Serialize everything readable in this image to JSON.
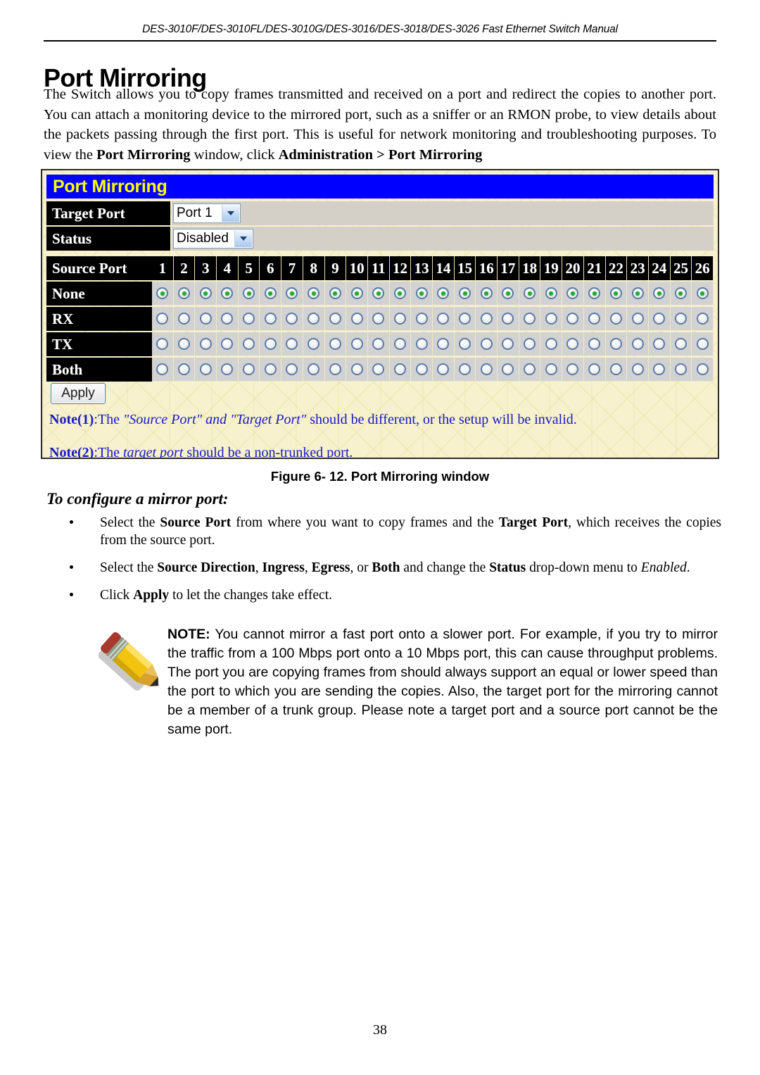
{
  "document": {
    "running_header": "DES-3010F/DES-3010FL/DES-3010G/DES-3016/DES-3018/DES-3026 Fast Ethernet Switch Manual",
    "page_title": "Port Mirroring",
    "page_number": "38"
  },
  "intro": {
    "paragraph_html": "The Switch allows you to copy frames transmitted and received on a port and redirect the copies to another port. You can attach a monitoring device to the mirrored port, such as a sniffer or an RMON probe, to view details about the packets passing through the first port. This is useful for network monitoring and troubleshooting purposes. To view the <b>Port Mirroring</b> window, click <b>Administration &gt; Port Mirroring</b>"
  },
  "screenshot": {
    "window_title": "Port Mirroring",
    "fields": [
      {
        "label": "Target Port",
        "value": "Port 1"
      },
      {
        "label": "Status",
        "value": "Disabled"
      }
    ],
    "source_port_label": "Source Port",
    "port_numbers": [
      "1",
      "2",
      "3",
      "4",
      "5",
      "6",
      "7",
      "8",
      "9",
      "10",
      "11",
      "12",
      "13",
      "14",
      "15",
      "16",
      "17",
      "18",
      "19",
      "20",
      "21",
      "22",
      "23",
      "24",
      "25",
      "26"
    ],
    "direction_rows": [
      {
        "label": "None",
        "selected": true
      },
      {
        "label": "RX",
        "selected": false
      },
      {
        "label": "TX",
        "selected": false
      },
      {
        "label": "Both",
        "selected": false
      }
    ],
    "apply_label": "Apply",
    "notes": [
      "Note(1):The \"Source Port\" and \"Target Port\" should be different, or the setup will be invalid.",
      "Note(2):The target port should be a non-trunked port."
    ],
    "note_html": [
      "<b>Note(1)</b>:The <i>\"Source Port\" and \"Target Port\"</i> should be different, or the setup will be invalid.",
      "<b>Note(2)</b>:The <i>target port</i> should be a non-trunked port."
    ],
    "colors": {
      "titlebar_bg": "#0000ff",
      "titlebar_fg": "#ffff00",
      "label_bg": "#000000",
      "label_fg": "#ffffff",
      "cell_bg": "#d2d2d2",
      "panel_bg": "#f7f2cd",
      "note_fg": "#1818c8",
      "radio_selected": "#1faf2f"
    }
  },
  "caption": "Figure 6- 12.  Port Mirroring window",
  "subheading": "To configure a mirror port:",
  "bullets": [
    "Select the <b>Source Port</b> from where you want to copy frames and the <b>Target Port</b>, which receives the copies from the source port.",
    "Select the <b>Source Direction</b>, <b>Ingress</b>, <b>Egress</b>, or <b>Both</b> and change the <b>Status</b> drop-down menu to <i>Enabled</i>.",
    "Click <b>Apply</b> to let the changes take effect."
  ],
  "note_block": {
    "icon": "pencil-icon",
    "text_html": "<b>NOTE:</b> You cannot mirror a fast port onto a slower port. For example, if you try to mirror the traffic from a 100 Mbps port onto a 10 Mbps port, this can cause throughput problems. The port you are copying frames from should always support an equal or lower speed than the port to which you are sending the copies. Also, the target port for the mirroring cannot be a member of a trunk group. Please note a target port and a source port cannot be the same port."
  }
}
